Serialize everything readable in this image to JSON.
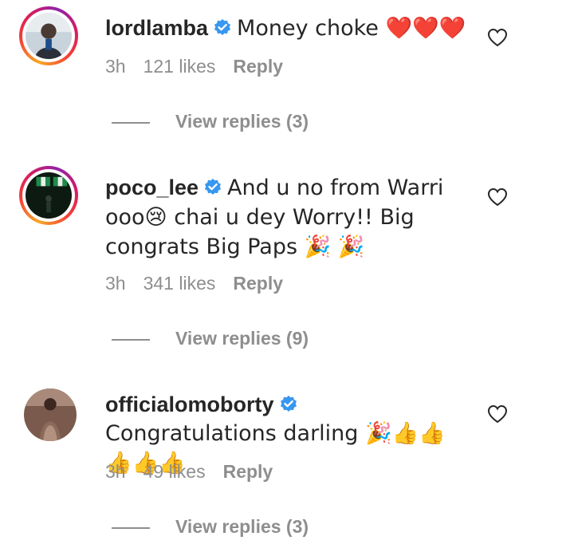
{
  "comments": [
    {
      "username": "lordlamba",
      "text": "Money choke ❤️❤️❤️",
      "time": "3h",
      "likes": "121 likes",
      "reply": "Reply",
      "view_replies": "View replies (3)",
      "has_story": true
    },
    {
      "username": "poco_lee",
      "text": "And u no from Warri ooo😢 chai u dey Worry!! Big congrats Big Paps 🎉 🎉",
      "time": "3h",
      "likes": "341 likes",
      "reply": "Reply",
      "view_replies": "View replies (9)",
      "has_story": true
    },
    {
      "username": "officialomoborty",
      "text": "Congratulations darling 🎉👍👍👍👍👍",
      "time": "3h",
      "likes": "49 likes",
      "reply": "Reply",
      "view_replies": "View replies (3)",
      "has_story": false
    }
  ],
  "icons": {
    "verified": "verified-badge-icon",
    "like": "heart-outline-icon"
  },
  "colors": {
    "verified_blue": "#3897f0",
    "meta_gray": "#8e8e8e",
    "text": "#262626"
  }
}
